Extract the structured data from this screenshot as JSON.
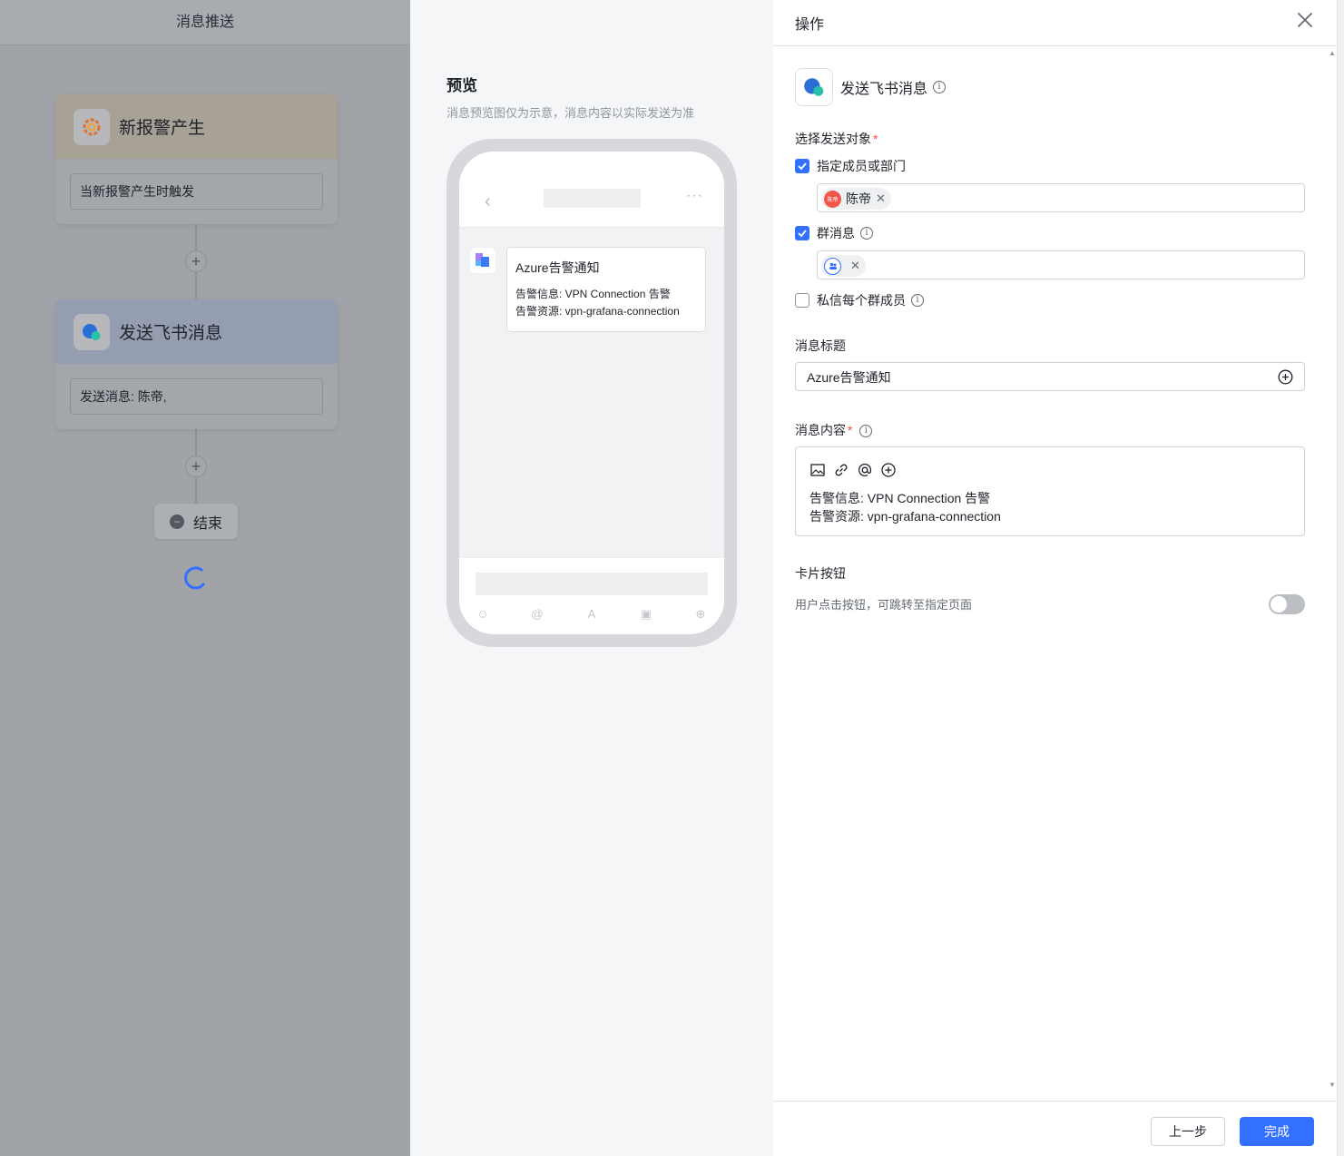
{
  "flow": {
    "header_title": "消息推送",
    "trigger_node": {
      "title": "新报警产生",
      "description": "当新报警产生时触发",
      "icon": "grafana-icon"
    },
    "action_node": {
      "title": "发送飞书消息",
      "description": "发送消息: 陈帝,",
      "icon": "lark-message-icon"
    },
    "add_symbol": "+",
    "end_node": {
      "label": "结束",
      "icon": "minus-circle-icon"
    }
  },
  "preview": {
    "title": "预览",
    "subtitle": "消息预览图仅为示意，消息内容以实际发送为准",
    "card_title": "Azure告警通知",
    "card_lines": [
      "告警信息: VPN Connection 告警",
      "告警资源: vpn-grafana-connection"
    ],
    "nav_back": "‹",
    "nav_more": "···",
    "toolbar_icons": [
      "emoji-icon",
      "mention-icon",
      "font-icon",
      "image-icon",
      "add-icon"
    ]
  },
  "panel": {
    "title": "操作",
    "action_name": "发送飞书消息",
    "recipients_label": "选择发送对象",
    "required_mark": "*",
    "option_members": {
      "label": "指定成员或部门",
      "checked": true
    },
    "member_tag": {
      "name": "陈帝",
      "avatar_text": "陈帝",
      "avatar_color": "#f0564a"
    },
    "option_group": {
      "label": "群消息",
      "checked": true
    },
    "option_dm": {
      "label": "私信每个群成员",
      "checked": false
    },
    "msg_title_label": "消息标题",
    "msg_title_value": "Azure告警通知",
    "msg_content_label": "消息内容",
    "msg_content_lines": [
      "告警信息: VPN Connection 告警",
      "告警资源: vpn-grafana-connection"
    ],
    "content_tools": [
      "image-icon",
      "link-icon",
      "at-icon",
      "add-icon"
    ],
    "card_button_label": "卡片按钮",
    "card_button_desc": "用户点击按钮，可跳转至指定页面",
    "card_button_enabled": false,
    "prev_button": "上一步",
    "done_button": "完成",
    "info_symbol": "i",
    "tag_close": "✕"
  },
  "colors": {
    "primary": "#3370ff",
    "required": "#f54a45",
    "toggle_off": "#bbbfc4"
  }
}
